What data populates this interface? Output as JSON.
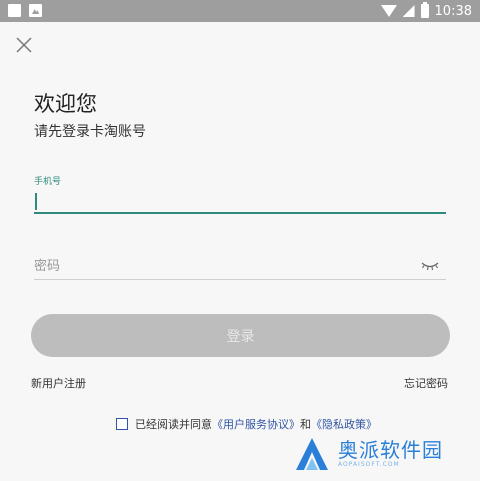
{
  "status_bar": {
    "time": "10:38",
    "icons": [
      "square-icon",
      "photo-icon",
      "wifi-icon",
      "cellular-icon",
      "battery-icon"
    ]
  },
  "header": {
    "close_icon": "close-icon"
  },
  "main": {
    "title": "欢迎您",
    "subtitle": "请先登录卡淘账号",
    "phone": {
      "label": "手机号",
      "value": ""
    },
    "password": {
      "placeholder": "密码",
      "toggle_icon": "eye-closed-icon"
    },
    "login_button": "登录",
    "register_link": "新用户注册",
    "forgot_link": "忘记密码",
    "agreement": {
      "prefix": "已经阅读并同意",
      "user_agreement": "《用户服务协议》",
      "conjunction": "和",
      "privacy_policy": "《隐私政策》",
      "checked": false
    }
  },
  "watermark": {
    "name_cn": "奥派软件园",
    "name_en": "AOPAISOFT.COM"
  },
  "colors": {
    "accent": "#2e8b7c",
    "link": "#2f55a4",
    "button_disabled": "#bdbdbd",
    "status_bar": "#9e9e9e"
  }
}
